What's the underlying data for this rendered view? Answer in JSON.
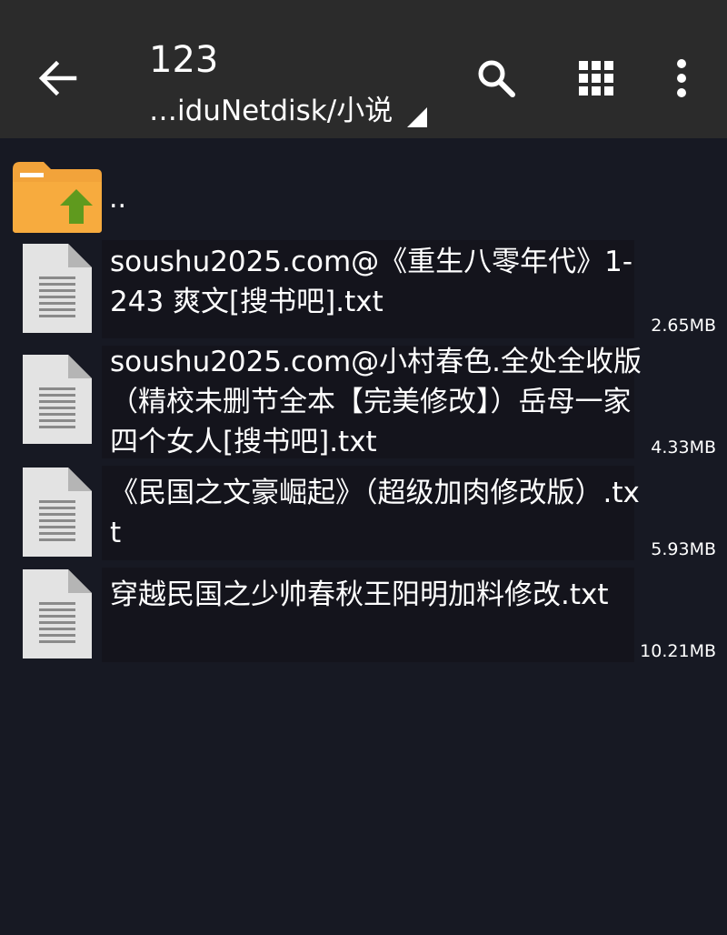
{
  "toolbar": {
    "title": "123",
    "path": "…iduNetdisk/小说",
    "back_icon": "arrow-left-icon",
    "search_icon": "search-icon",
    "grid_icon": "grid-view-icon",
    "more_icon": "more-vert-icon"
  },
  "parent_entry": {
    "label": ".."
  },
  "files": [
    {
      "name": "soushu2025.com@《重生八零年代》1-243 爽文[搜书吧].txt",
      "size": "2.65MB"
    },
    {
      "name": "soushu2025.com@小村春色.全处全收版（精校未删节全本【完美修改】）岳母一家四个女人[搜书吧].txt",
      "size": "4.33MB"
    },
    {
      "name": "《民国之文豪崛起》（超级加肉修改版）.txt",
      "size": "5.93MB"
    },
    {
      "name": "穿越民国之少帅春秋王阳明加料修改.txt",
      "size": "10.21MB"
    }
  ],
  "colors": {
    "toolbar_bg": "#2b2b2b",
    "page_bg": "#171923",
    "folder_orange": "#f5a623",
    "folder_arrow_green": "#6a9a2a",
    "file_icon_gray": "#e0e0e0"
  }
}
